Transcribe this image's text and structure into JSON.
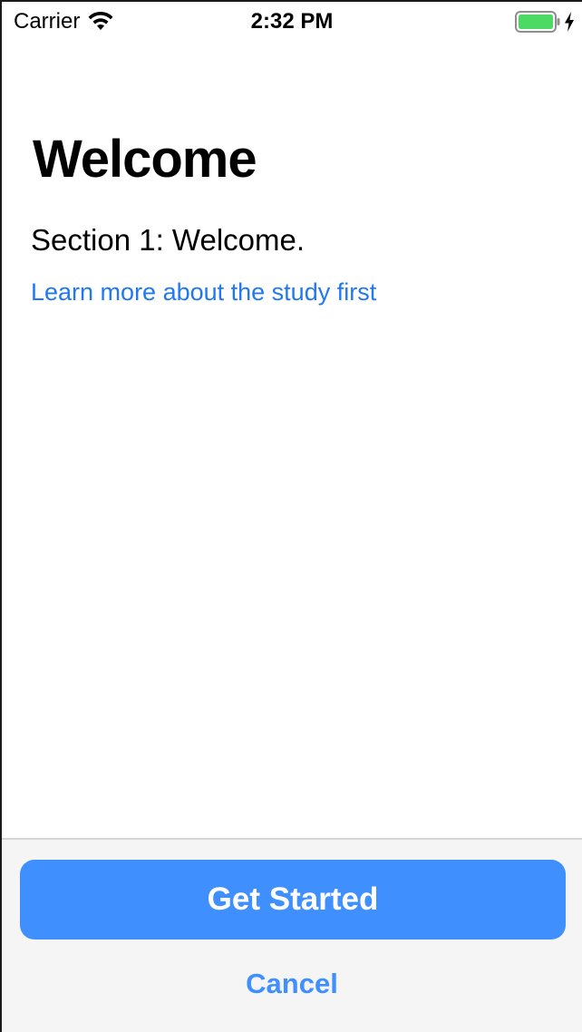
{
  "status_bar": {
    "carrier": "Carrier",
    "time": "2:32 PM",
    "icons": [
      "wifi-icon",
      "battery-icon",
      "charging-bolt-icon"
    ],
    "battery_color": "#4cd964"
  },
  "content": {
    "title": "Welcome",
    "section_text": "Section 1: Welcome.",
    "learn_more_link": "Learn more about the study first"
  },
  "footer": {
    "primary_button_label": "Get Started",
    "cancel_label": "Cancel"
  },
  "colors": {
    "accent": "#3f8ffe",
    "link": "#2178f0",
    "footer_background": "#f5f5f5"
  }
}
